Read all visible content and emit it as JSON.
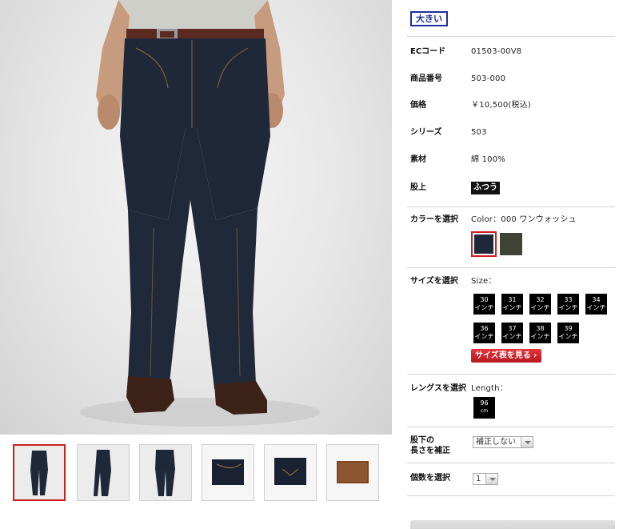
{
  "photo": {
    "alt": "product-photo"
  },
  "thumbnails": [
    {
      "name": "thumb-front",
      "selected": true
    },
    {
      "name": "thumb-side",
      "selected": false
    },
    {
      "name": "thumb-back",
      "selected": false
    },
    {
      "name": "thumb-pocket",
      "selected": false
    },
    {
      "name": "thumb-back-pocket",
      "selected": false
    },
    {
      "name": "thumb-label",
      "selected": false
    }
  ],
  "panel": {
    "font_size_label": "大きい",
    "specs": [
      {
        "label": "ECコード",
        "value": "01503-00V8"
      },
      {
        "label": "商品番号",
        "value": "503-000"
      },
      {
        "label": "価格",
        "value": "￥10,500(税込)"
      },
      {
        "label": "シリーズ",
        "value": "503"
      },
      {
        "label": "素材",
        "value": "綿 100%"
      },
      {
        "label": "股上",
        "value": "ふつう"
      }
    ],
    "color": {
      "label": "カラーを選択",
      "current": "Color：000 ワンウォッシュ",
      "swatches": [
        {
          "name": "indigo",
          "hex": "#1e2838",
          "selected": true
        },
        {
          "name": "olive",
          "hex": "#3f4436",
          "selected": false
        }
      ]
    },
    "size": {
      "label": "サイズを選択",
      "caption": "Size：",
      "unit": "インチ",
      "values": [
        "30",
        "31",
        "32",
        "33",
        "34",
        "36",
        "37",
        "38",
        "39"
      ],
      "chart_button": "サイズ表を見る"
    },
    "length": {
      "label": "レングスを選択",
      "caption": "Length：",
      "values": [
        {
          "num": "96",
          "unit": "cm"
        }
      ]
    },
    "hem": {
      "label_line1": "股下の",
      "label_line2": "長さを補正",
      "selected": "補正しない"
    },
    "quantity": {
      "label": "個数を選択",
      "selected": "1"
    }
  },
  "colors": {
    "accent_red": "#c8201e",
    "badge_blue": "#1f2f9f",
    "denim": "#1e2838"
  }
}
